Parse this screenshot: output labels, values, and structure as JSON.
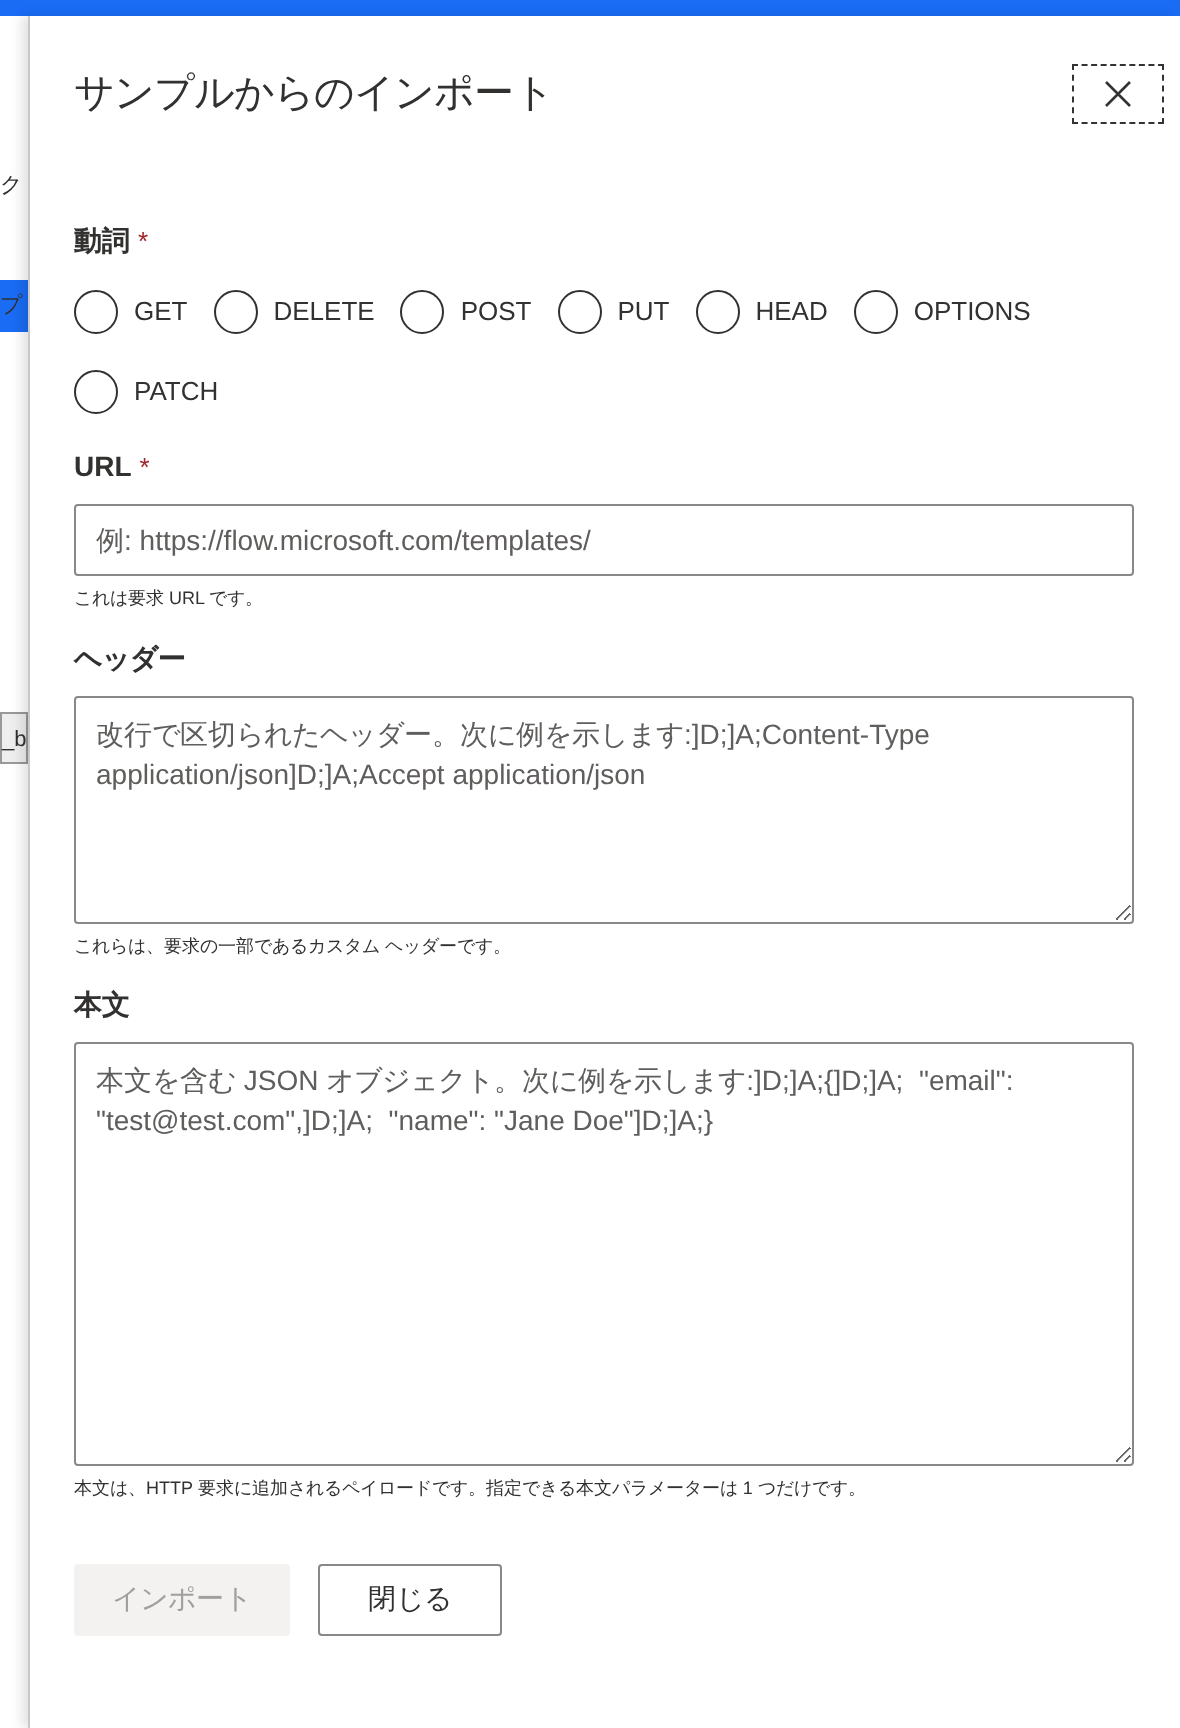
{
  "background": {
    "fragments": [
      {
        "text": "ク",
        "kind": "plain"
      },
      {
        "text": "プ",
        "kind": "highlight"
      },
      {
        "text": "_b",
        "kind": "box"
      }
    ]
  },
  "dialog": {
    "title": "サンプルからのインポート",
    "verb": {
      "label": "動詞",
      "required_mark": "*",
      "options": [
        {
          "label": "GET",
          "selected": false
        },
        {
          "label": "DELETE",
          "selected": false
        },
        {
          "label": "POST",
          "selected": false
        },
        {
          "label": "PUT",
          "selected": false
        },
        {
          "label": "HEAD",
          "selected": false
        },
        {
          "label": "OPTIONS",
          "selected": false
        },
        {
          "label": "PATCH",
          "selected": false
        }
      ]
    },
    "url": {
      "label": "URL",
      "required_mark": "*",
      "placeholder": "例: https://flow.microsoft.com/templates/",
      "hint": "これは要求 URL です。"
    },
    "headers": {
      "label": "ヘッダー",
      "placeholder": "改行で区切られたヘッダー。次に例を示します:]D;]A;Content-Type application/json]D;]A;Accept application/json",
      "hint": "これらは、要求の一部であるカスタム ヘッダーです。"
    },
    "body": {
      "label": "本文",
      "placeholder": "本文を含む JSON オブジェクト。次に例を示します:]D;]A;{]D;]A;  \"email\": \"test@test.com\",]D;]A;  \"name\": \"Jane Doe\"]D;]A;}",
      "hint": "本文は、HTTP 要求に追加されるペイロードです。指定できる本文パラメーターは 1 つだけです。"
    },
    "buttons": [
      {
        "label": "インポート",
        "disabled": true
      },
      {
        "label": "閉じる",
        "disabled": false
      }
    ]
  }
}
